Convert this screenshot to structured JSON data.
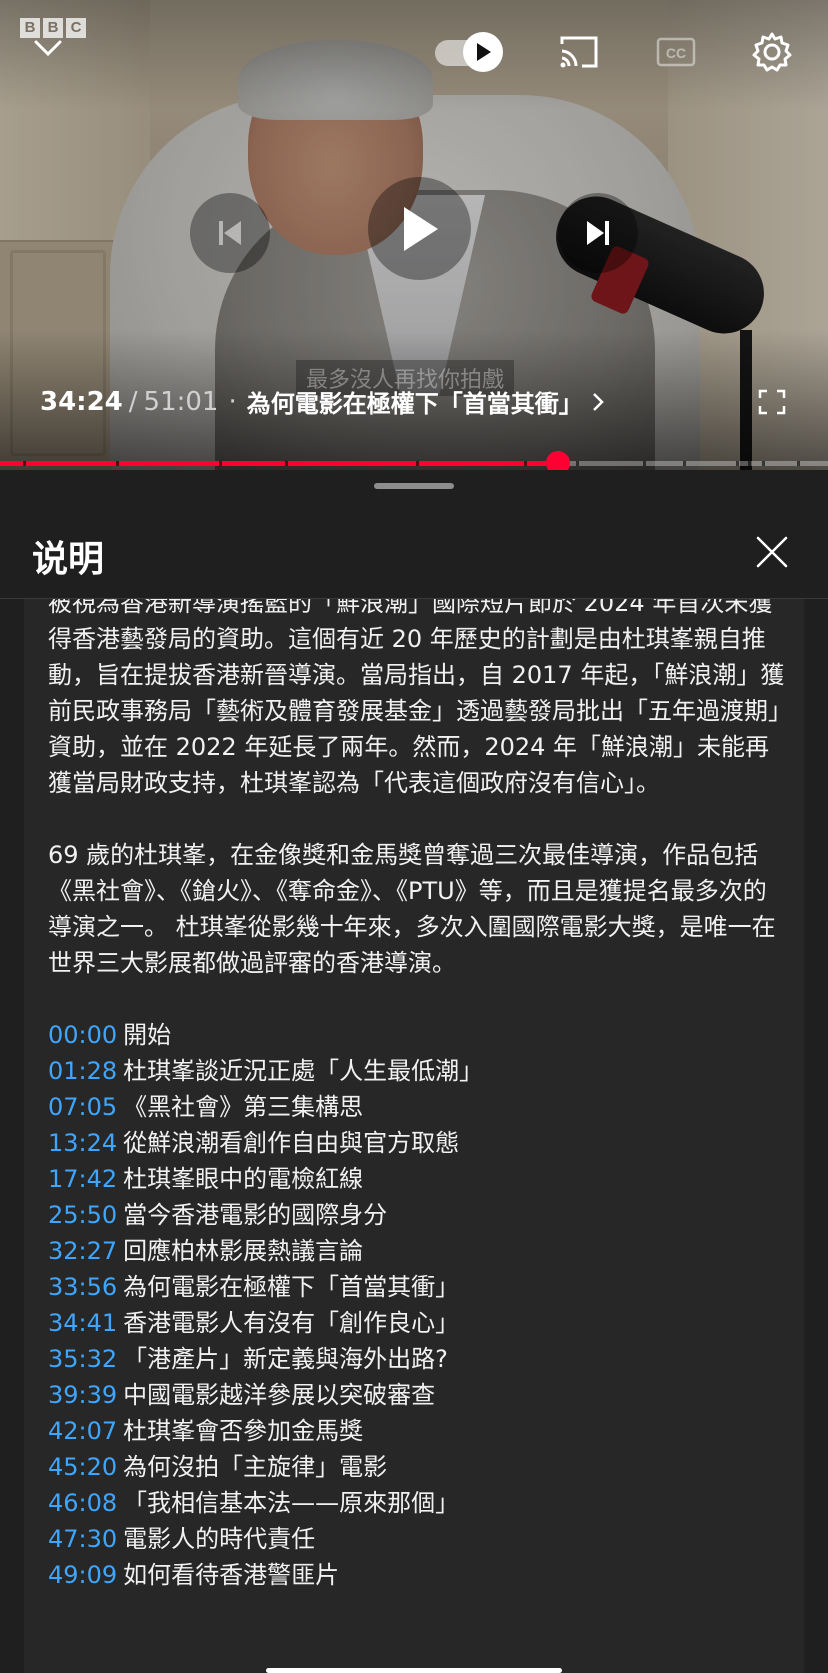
{
  "player": {
    "logo_letters": [
      "B",
      "B",
      "C"
    ],
    "caption_text": "最多沒人再找你拍戲",
    "time_current": "34:24",
    "time_separator": "/",
    "time_total": "51:01",
    "chapter_dot": "·",
    "chapter_title": "為何電影在極權下「首當其衝」",
    "progress_fraction": 0.674,
    "chapter_marker_fractions": [
      0.028,
      0.14,
      0.264,
      0.344,
      0.503,
      0.633,
      0.659,
      0.68,
      0.696,
      0.777,
      0.825,
      0.889,
      0.903,
      0.92,
      0.962
    ],
    "icons": {
      "collapse": "chevron-down-icon",
      "autoplay": "autoplay-toggle-icon",
      "cast": "cast-icon",
      "captions": "closed-captions-icon",
      "settings": "gear-icon",
      "previous": "skip-previous-icon",
      "play": "play-icon",
      "next": "skip-next-icon",
      "fullscreen": "fullscreen-icon"
    },
    "accent_color": "#ff0033"
  },
  "sheet": {
    "title": "说明",
    "close_icon": "close-icon",
    "paragraphs": [
      "被視為香港新導演搖籃的「鮮浪潮」國際短片節於 2024 年首次未獲得香港藝發局的資助。這個有近 20 年歷史的計劃是由杜琪峯親自推動，旨在提拔香港新晉導演。當局指出，自 2017 年起，「鮮浪潮」獲前民政事務局「藝術及體育發展基金」透過藝發局批出「五年過渡期」資助，並在 2022 年延長了兩年。然而，2024 年「鮮浪潮」未能再獲當局財政支持，杜琪峯認為「代表這個政府沒有信心」。",
      "69 歲的杜琪峯，在金像獎和金馬獎曾奪過三次最佳導演，作品包括《黑社會》、《鎗火》、《奪命金》、《PTU》等，而且是獲提名最多次的導演之一。 杜琪峯從影幾十年來，多次入圍國際電影大獎，是唯一在世界三大影展都做過評審的香港導演。"
    ],
    "chapters": [
      {
        "time": "00:00",
        "title": "開始"
      },
      {
        "time": "01:28",
        "title": "杜琪峯談近況正處「人生最低潮」"
      },
      {
        "time": "07:05",
        "title": "《黑社會》第三集構思"
      },
      {
        "time": "13:24",
        "title": "從鮮浪潮看創作自由與官方取態"
      },
      {
        "time": "17:42",
        "title": "杜琪峯眼中的電檢紅線"
      },
      {
        "time": "25:50",
        "title": "當今香港電影的國際身分"
      },
      {
        "time": "32:27",
        "title": "回應柏林影展熱議言論"
      },
      {
        "time": "33:56",
        "title": "為何電影在極權下「首當其衝」"
      },
      {
        "time": "34:41",
        "title": "香港電影人有沒有「創作良心」"
      },
      {
        "time": "35:32",
        "title": "「港產片」新定義與海外出路?"
      },
      {
        "time": "39:39",
        "title": "中國電影越洋參展以突破審查"
      },
      {
        "time": "42:07",
        "title": "杜琪峯會否參加金馬獎"
      },
      {
        "time": "45:20",
        "title": "為何沒拍「主旋律」電影"
      },
      {
        "time": "46:08",
        "title": "「我相信基本法——原來那個」"
      },
      {
        "time": "47:30",
        "title": "電影人的時代責任"
      },
      {
        "time": "49:09",
        "title": "如何看待香港警匪片"
      }
    ],
    "timestamp_color": "#3ea6ff"
  }
}
